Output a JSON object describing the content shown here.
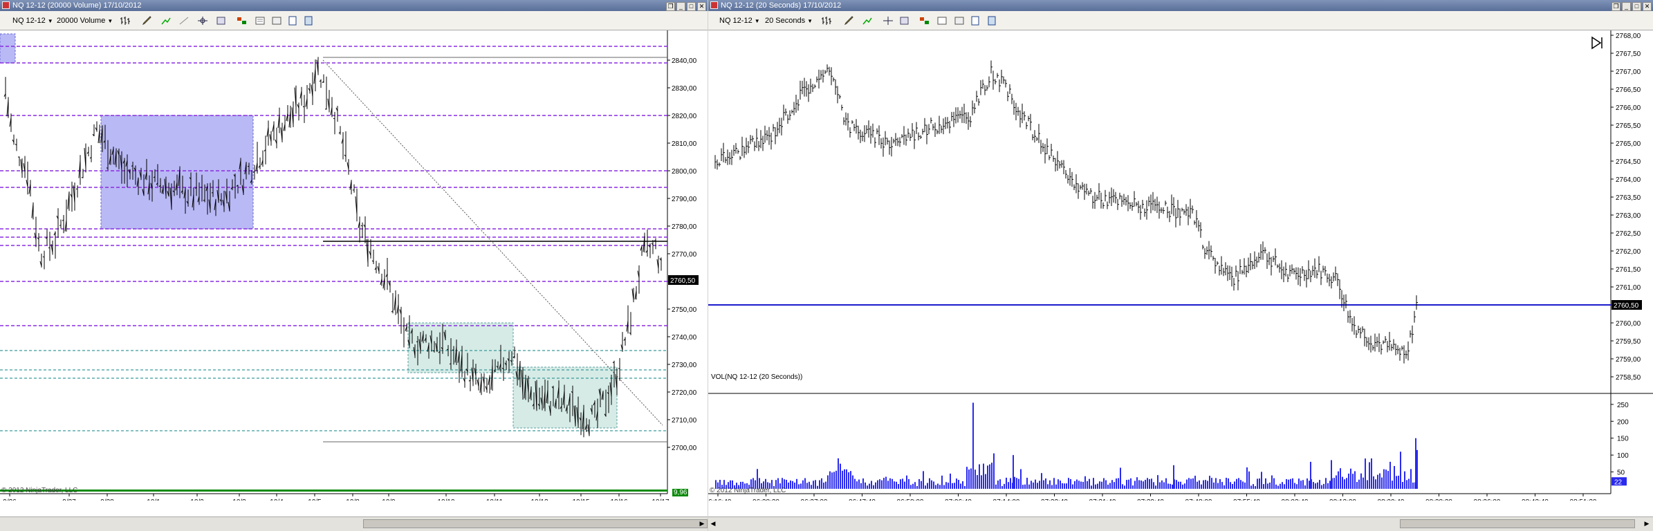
{
  "left_window": {
    "title": "NQ 12-12 (20000 Volume)  17/10/2012",
    "instrument": "NQ 12-12",
    "interval": "20000 Volume",
    "price_axis": [
      "2840,00",
      "2830,00",
      "2820,00",
      "2810,00",
      "2800,00",
      "2790,00",
      "2780,00",
      "2770,00",
      "2760,00",
      "2750,00",
      "2740,00",
      "2730,00",
      "2720,00",
      "2710,00",
      "2700,00"
    ],
    "date_axis": [
      "9/26",
      "9/27",
      "9/28",
      "10/1",
      "10/2",
      "10/3",
      "10/4",
      "10/5",
      "10/8",
      "10/9",
      "10/10",
      "10/11",
      "10/12",
      "10/15",
      "10/16",
      "10/17"
    ],
    "last_price": "2760,50",
    "volume_marker": "9,96",
    "copyright": "© 2012 NinjaTrader, LLC",
    "colors": {
      "purple_line": "#8a2be2",
      "teal_line": "#3a9a9a",
      "zone_blue": "#b9b9f5",
      "zone_teal": "#d6ebe6"
    }
  },
  "right_window": {
    "title": "NQ 12-12 (20 Seconds)  17/10/2012",
    "instrument": "NQ 12-12",
    "interval": "20 Seconds",
    "price_axis": [
      "2768,00",
      "2767,50",
      "2767,00",
      "2766,50",
      "2766,00",
      "2765,50",
      "2765,00",
      "2764,50",
      "2764,00",
      "2763,50",
      "2763,00",
      "2762,50",
      "2762,00",
      "2761,50",
      "2761,00",
      "2760,50",
      "2760,00",
      "2759,50",
      "2759,00",
      "2758,50"
    ],
    "time_axis": [
      "06:16:40",
      "06:28:20",
      "06:37:00",
      "06:47:40",
      "06:58:00",
      "07:06:40",
      "07:14:00",
      "07:22:40",
      "07:31:40",
      "07:39:40",
      "07:48:00",
      "07:55:40",
      "08:03:40",
      "08:12:00",
      "08:20:40",
      "08:28:20",
      "08:36:00",
      "08:43:40",
      "08:51:20"
    ],
    "last_price": "2760,50",
    "volume_panel_label": "VOL(NQ 12-12 (20 Seconds))",
    "volume_axis": [
      "250",
      "200",
      "150",
      "100",
      "50"
    ],
    "volume_marker": "22",
    "copyright": "© 2012 NinjaTrader, LLC",
    "colors": {
      "line": "#1a1acc",
      "volume": "#2a2aee"
    }
  }
}
